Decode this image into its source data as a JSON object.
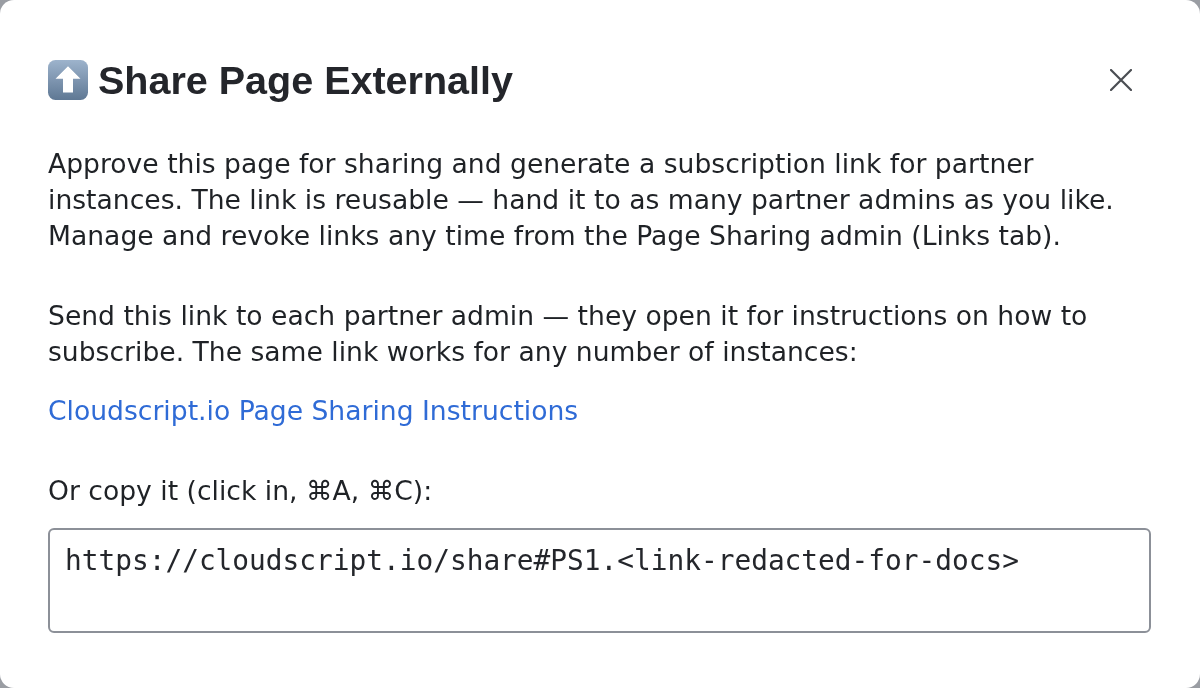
{
  "dialog": {
    "title": "Share Page Externally",
    "paragraphs": [
      "Approve this page for sharing and generate a subscription link for partner instances. The link is reusable — hand it to as many partner admins as you like. Manage and revoke links any time from the Page Sharing admin (Links tab).",
      "Send this link to each partner admin — they open it for instructions on how to subscribe. The same link works for any number of instances:"
    ],
    "link": {
      "label": "Cloudscript.io Page Sharing Instructions"
    },
    "copy": {
      "label": "Or copy it (click in, ⌘A, ⌘C):",
      "value": "https://cloudscript.io/share#PS1.<link-redacted-for-docs>"
    }
  }
}
